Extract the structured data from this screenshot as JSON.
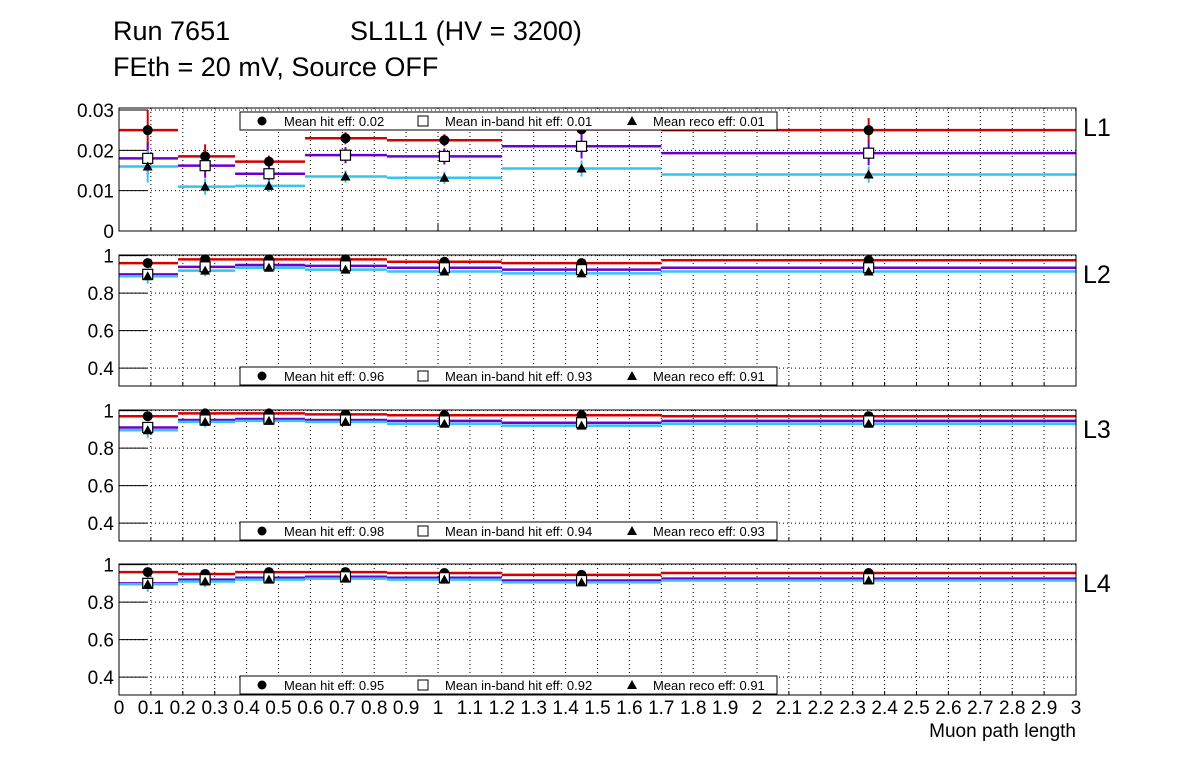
{
  "header": {
    "run": "Run 7651",
    "chamber": "SL1L1 (HV = 3200)",
    "conditions": "FEth = 20 mV, Source OFF"
  },
  "colors": {
    "hit": "#d40000",
    "inband": "#6a00d4",
    "reco": "#33c4f0",
    "marker": "#000000"
  },
  "chart_data": {
    "type": "line",
    "xlabel": "Muon path length",
    "xlim": [
      0,
      3
    ],
    "x_ticks": [
      "0",
      "0.1",
      "0.2",
      "0.3",
      "0.4",
      "0.5",
      "0.6",
      "0.7",
      "0.8",
      "0.9",
      "1",
      "1.1",
      "1.2",
      "1.3",
      "1.4",
      "1.5",
      "1.6",
      "1.7",
      "1.8",
      "1.9",
      "2",
      "2.1",
      "2.2",
      "2.3",
      "2.4",
      "2.5",
      "2.6",
      "2.7",
      "2.8",
      "2.9",
      "3"
    ],
    "bin_edges": [
      0,
      0.185,
      0.364,
      0.583,
      0.84,
      1.2,
      1.7,
      3.0
    ],
    "point_x": [
      0.09,
      0.27,
      0.47,
      0.71,
      1.02,
      1.45,
      2.35
    ],
    "grid": true,
    "panels": [
      {
        "label": "L1",
        "ylim": [
          0,
          0.0305
        ],
        "y_ticks": [
          "0",
          "0.01",
          "0.02",
          "0.03"
        ],
        "y_tick_values": [
          0,
          0.01,
          0.02,
          0.03
        ],
        "legend_position": "top",
        "legend": [
          "Mean hit  eff: 0.02",
          "Mean in-band hit eff: 0.01",
          "Mean reco eff: 0.01"
        ],
        "series": [
          {
            "name": "hit",
            "values": [
              0.025,
              0.0185,
              0.0172,
              0.023,
              0.0225,
              0.0252,
              0.025
            ],
            "err": [
              0.005,
              0.003,
              0.0015,
              0.0015,
              0.0015,
              0.002,
              0.003
            ]
          },
          {
            "name": "inband",
            "values": [
              0.018,
              0.0162,
              0.0142,
              0.0188,
              0.0185,
              0.021,
              0.0193
            ],
            "err": [
              0.004,
              0.003,
              0.002,
              0.002,
              0.002,
              0.003,
              0.003
            ]
          },
          {
            "name": "reco",
            "values": [
              0.016,
              0.011,
              0.0112,
              0.0135,
              0.0132,
              0.0155,
              0.014
            ],
            "err": [
              0.004,
              0.002,
              0.0015,
              0.0015,
              0.0015,
              0.002,
              0.002
            ]
          }
        ]
      },
      {
        "label": "L2",
        "ylim": [
          0.305,
          1.003
        ],
        "y_ticks": [
          "0.4",
          "0.6",
          "0.8",
          "1"
        ],
        "y_tick_values": [
          0.4,
          0.6,
          0.8,
          1
        ],
        "legend_position": "bottom",
        "legend": [
          "Mean hit  eff: 0.96",
          "Mean in-band hit eff: 0.93",
          "Mean reco eff: 0.91"
        ],
        "series": [
          {
            "name": "hit",
            "values": [
              0.96,
              0.98,
              0.98,
              0.98,
              0.967,
              0.96,
              0.975
            ],
            "err": [
              0.02,
              0.01,
              0.01,
              0.01,
              0.01,
              0.01,
              0.01
            ]
          },
          {
            "name": "inband",
            "values": [
              0.9,
              0.94,
              0.95,
              0.945,
              0.935,
              0.925,
              0.935
            ],
            "err": [
              0.03,
              0.02,
              0.015,
              0.015,
              0.015,
              0.015,
              0.02
            ]
          },
          {
            "name": "reco",
            "values": [
              0.89,
              0.92,
              0.935,
              0.925,
              0.915,
              0.905,
              0.915
            ],
            "err": [
              0.04,
              0.03,
              0.02,
              0.02,
              0.02,
              0.02,
              0.02
            ]
          }
        ]
      },
      {
        "label": "L3",
        "ylim": [
          0.305,
          1.003
        ],
        "y_ticks": [
          "0.4",
          "0.6",
          "0.8",
          "1"
        ],
        "y_tick_values": [
          0.4,
          0.6,
          0.8,
          1
        ],
        "legend_position": "bottom",
        "legend": [
          "Mean hit  eff: 0.98",
          "Mean in-band hit eff: 0.94",
          "Mean reco eff: 0.93"
        ],
        "series": [
          {
            "name": "hit",
            "values": [
              0.97,
              0.985,
              0.985,
              0.98,
              0.975,
              0.975,
              0.97
            ],
            "err": [
              0.02,
              0.01,
              0.01,
              0.01,
              0.01,
              0.01,
              0.01
            ]
          },
          {
            "name": "inband",
            "values": [
              0.91,
              0.95,
              0.955,
              0.95,
              0.945,
              0.935,
              0.945
            ],
            "err": [
              0.03,
              0.02,
              0.015,
              0.015,
              0.015,
              0.015,
              0.02
            ]
          },
          {
            "name": "reco",
            "values": [
              0.895,
              0.94,
              0.945,
              0.94,
              0.93,
              0.92,
              0.93
            ],
            "err": [
              0.04,
              0.03,
              0.02,
              0.02,
              0.02,
              0.02,
              0.02
            ]
          }
        ]
      },
      {
        "label": "L4",
        "ylim": [
          0.305,
          1.003
        ],
        "y_ticks": [
          "0.4",
          "0.6",
          "0.8",
          "1"
        ],
        "y_tick_values": [
          0.4,
          0.6,
          0.8,
          1
        ],
        "legend_position": "bottom",
        "legend": [
          "Mean hit  eff: 0.95",
          "Mean in-band hit eff: 0.92",
          "Mean reco eff: 0.91"
        ],
        "series": [
          {
            "name": "hit",
            "values": [
              0.96,
              0.95,
              0.96,
              0.96,
              0.955,
              0.945,
              0.955
            ],
            "err": [
              0.02,
              0.015,
              0.01,
              0.01,
              0.01,
              0.01,
              0.015
            ]
          },
          {
            "name": "inband",
            "values": [
              0.9,
              0.92,
              0.93,
              0.935,
              0.93,
              0.915,
              0.925
            ],
            "err": [
              0.03,
              0.02,
              0.015,
              0.015,
              0.015,
              0.015,
              0.02
            ]
          },
          {
            "name": "reco",
            "values": [
              0.895,
              0.91,
              0.92,
              0.925,
              0.92,
              0.905,
              0.915
            ],
            "err": [
              0.04,
              0.03,
              0.02,
              0.02,
              0.02,
              0.02,
              0.02
            ]
          }
        ]
      }
    ]
  }
}
